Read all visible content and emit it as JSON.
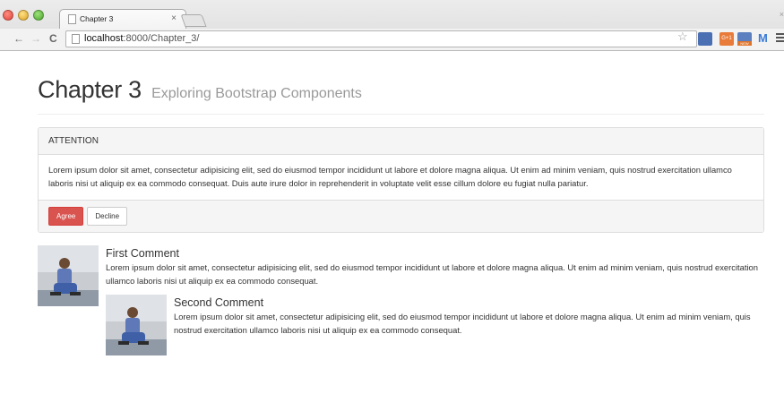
{
  "browser": {
    "tab_title": "Chapter 3",
    "tab_close": "×",
    "url_host": "localhost",
    "url_path": ":8000/Chapter_3/",
    "gplus_label": "G+1",
    "new_label": "NEW",
    "gmail_label": "M",
    "icons": [
      "back-arrow-icon",
      "forward-arrow-icon",
      "reload-icon",
      "page-icon",
      "star-icon",
      "menu-icon"
    ]
  },
  "header": {
    "title": "Chapter 3",
    "subtitle": "Exploring Bootstrap Components"
  },
  "panel": {
    "heading": "ATTENTION",
    "body": "Lorem ipsum dolor sit amet, consectetur adipisicing elit, sed do eiusmod tempor incididunt ut labore et dolore magna aliqua. Ut enim ad minim veniam, quis nostrud exercitation ullamco laboris nisi ut aliquip ex ea commodo consequat. Duis aute irure dolor in reprehenderit in voluptate velit esse cillum dolore eu fugiat nulla pariatur.",
    "agree_label": "Agree",
    "decline_label": "Decline"
  },
  "comments": [
    {
      "heading": "First Comment",
      "text": "Lorem ipsum dolor sit amet, consectetur adipisicing elit, sed do eiusmod tempor incididunt ut labore et dolore magna aliqua. Ut enim ad minim veniam, quis nostrud exercitation ullamco laboris nisi ut aliquip ex ea commodo consequat."
    },
    {
      "heading": "Second Comment",
      "text": "Lorem ipsum dolor sit amet, consectetur adipisicing elit, sed do eiusmod tempor incididunt ut labore et dolore magna aliqua. Ut enim ad minim veniam, quis nostrud exercitation ullamco laboris nisi ut aliquip ex ea commodo consequat."
    }
  ],
  "colors": {
    "danger": "#d9534f",
    "panel_bg": "#f5f5f5",
    "border": "#dddddd"
  }
}
